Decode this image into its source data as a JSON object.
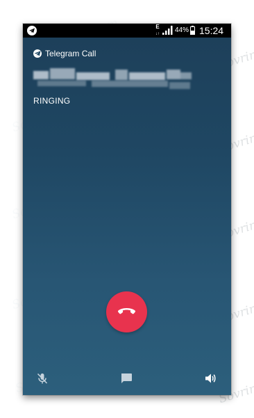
{
  "status_bar": {
    "network_type": "E",
    "network_sub": "↓↑",
    "battery_percent": "44%",
    "time": "15:24",
    "left_icon": "telegram-icon",
    "signal_icon": "signal-bars-icon",
    "battery_icon": "battery-icon"
  },
  "call": {
    "app_name": "Telegram Call",
    "app_icon": "telegram-icon",
    "status": "RINGING"
  },
  "controls": {
    "hangup_icon": "phone-hangup-icon",
    "mute_icon": "mic-off-icon",
    "message_icon": "message-icon",
    "speaker_icon": "speaker-icon"
  },
  "watermark": {
    "text": "Sovring.ru.com"
  },
  "colors": {
    "background_top": "#1d3f59",
    "background_bottom": "#2c5f7c",
    "hangup": "#e8334e",
    "status_bar": "#000000"
  }
}
